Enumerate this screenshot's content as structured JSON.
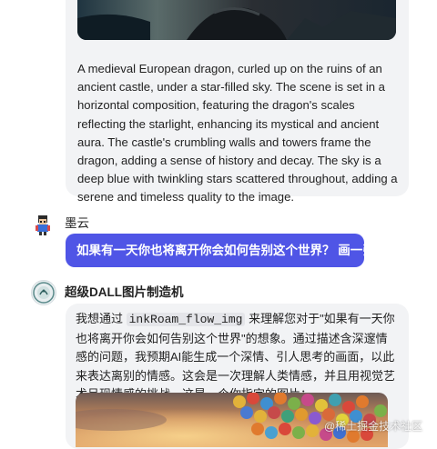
{
  "messages": {
    "bot_reply_1": "A medieval European dragon, curled up on the ruins of an ancient castle, under a star-filled sky. The scene is set in a horizontal composition, featuring the dragon's scales reflecting the starlight, enhancing its mystical and ancient aura. The castle's crumbling walls and towers frame the dragon, adding a sense of history and decay. The sky is a deep blue with twinkling stars scattered throughout, adding a serene and timeless quality to the image.",
    "user_name": "墨云",
    "user_message": "如果有一天你也将离开你会如何告别这个世界？ 画一张图",
    "bot_name": "超级DALL图片制造机",
    "bot_reply_2_before": "我想通过 ",
    "bot_reply_2_code": "inkRoam_flow_img",
    "bot_reply_2_after": " 来理解您对于\"如果有一天你也将离开你会如何告别这个世界\"的想象。通过描述含深邃情感的问题，我预期AI能生成一个深情、引人思考的画面，以此来表达离别的情感。这会是一次理解人类情感，并且用视觉艺术呈现情感的挑战。这是一个你指定的图片："
  },
  "watermark": "@稀土掘金技术社区",
  "colors": {
    "user_bubble": "#4f55e6",
    "bot_bubble": "#f2f3f5"
  },
  "icons": {
    "user_avatar": "pixel-character-avatar",
    "bot_avatar": "logo-avatar"
  }
}
